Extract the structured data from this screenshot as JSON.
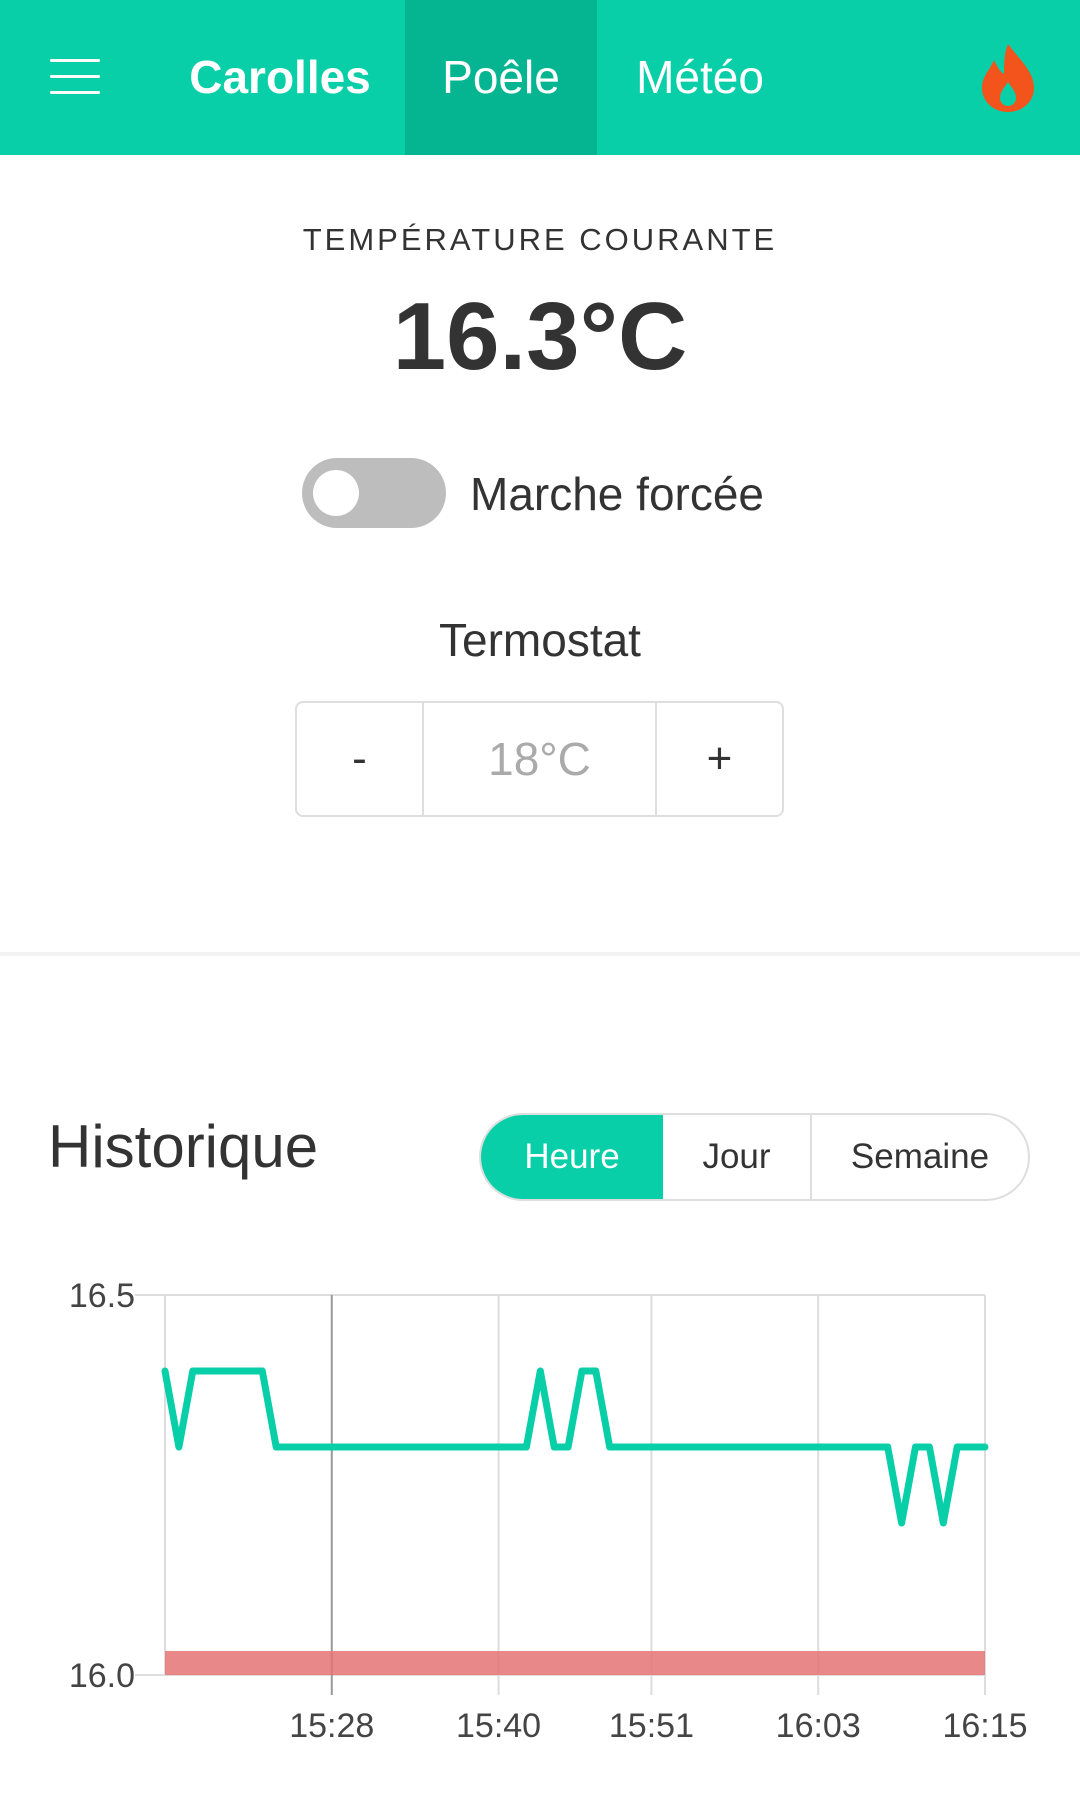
{
  "header": {
    "menu_icon": "hamburger-icon",
    "tabs": [
      {
        "label": "Carolles"
      },
      {
        "label": "Poêle"
      },
      {
        "label": "Météo"
      }
    ],
    "status_icon": "flame-icon",
    "accent": "#09cfa8",
    "active_tab_bg": "#05b592",
    "flame_color": "#f2541b"
  },
  "current": {
    "label": "TEMPÉRATURE COURANTE",
    "value": "16.3°C"
  },
  "forced": {
    "label": "Marche forcée",
    "on": false
  },
  "thermostat": {
    "label": "Termostat",
    "minus": "-",
    "value": "18°C",
    "plus": "+"
  },
  "history": {
    "title": "Historique",
    "ranges": [
      "Heure",
      "Jour",
      "Semaine"
    ],
    "selected": "Heure"
  },
  "chart_data": {
    "type": "line",
    "ylim": [
      16.0,
      16.5
    ],
    "yticks": [
      "16.5",
      "16.0"
    ],
    "xticks": [
      "15:28",
      "15:40",
      "15:51",
      "16:03",
      "16:15"
    ],
    "grid": true,
    "series": [
      {
        "color": "#09cfa8",
        "points": [
          [
            "15:16",
            16.4
          ],
          [
            "15:17",
            16.3
          ],
          [
            "15:18",
            16.4
          ],
          [
            "15:23",
            16.4
          ],
          [
            "15:24",
            16.3
          ],
          [
            "15:42",
            16.3
          ],
          [
            "15:43",
            16.4
          ],
          [
            "15:44",
            16.3
          ],
          [
            "15:45",
            16.3
          ],
          [
            "15:46",
            16.4
          ],
          [
            "15:47",
            16.4
          ],
          [
            "15:48",
            16.3
          ],
          [
            "16:08",
            16.3
          ],
          [
            "16:09",
            16.2
          ],
          [
            "16:10",
            16.3
          ],
          [
            "16:11",
            16.3
          ],
          [
            "16:12",
            16.2
          ],
          [
            "16:13",
            16.3
          ],
          [
            "16:15",
            16.3
          ]
        ]
      },
      {
        "color": "#e57373",
        "band": true,
        "points": [
          [
            "15:16",
            16.0
          ],
          [
            "16:15",
            16.0
          ]
        ]
      }
    ]
  }
}
